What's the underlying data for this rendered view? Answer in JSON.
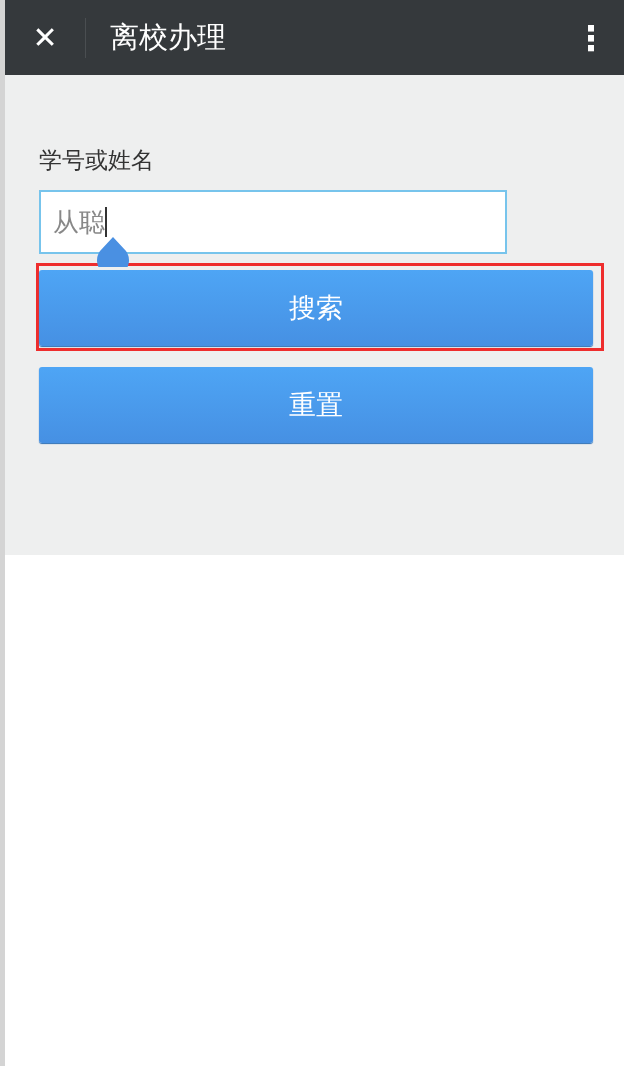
{
  "header": {
    "close_icon": "✕",
    "title": "离校办理",
    "menu_icon": "⋮"
  },
  "form": {
    "label": "学号或姓名",
    "field": {
      "value": "从聪",
      "focused": true
    },
    "buttons": [
      {
        "label": "搜索",
        "highlighted": true
      },
      {
        "label": "重置",
        "highlighted": false
      }
    ]
  }
}
